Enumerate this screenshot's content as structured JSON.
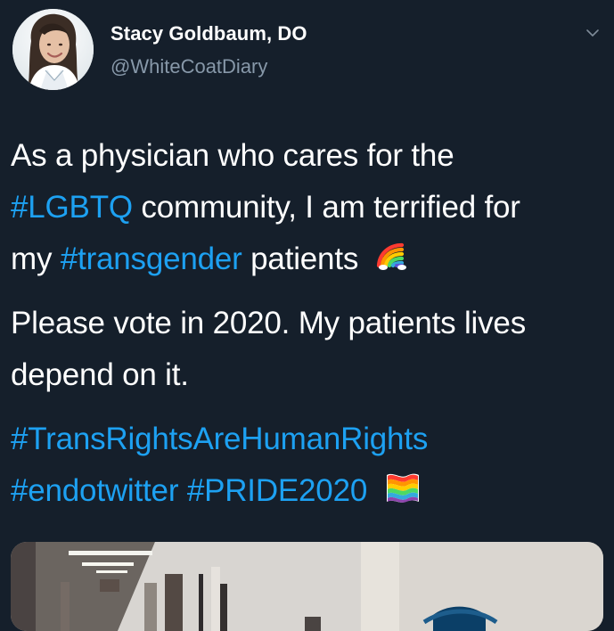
{
  "profile": {
    "display_name": "Stacy Goldbaum, DO",
    "handle": "@WhiteCoatDiary",
    "avatar_icon": "person-avatar"
  },
  "tweet": {
    "line1": "As a physician who cares for the",
    "line2_hashtag": "#LGBTQ",
    "line2_text": " community, I am terrified for",
    "line3_prefix": "my ",
    "line3_hashtag": "#transgender",
    "line3_suffix": " patients",
    "line4": "Please vote in 2020. My patients lives",
    "line5": "depend on it.",
    "hashtag1": "#TransRightsAreHumanRights",
    "hashtag2": "#endotwitter",
    "hashtag3": "#PRIDE2020",
    "emoji1": "rainbow-emoji",
    "emoji2": "pride-flag-emoji"
  },
  "colors": {
    "background": "#151f2b",
    "text": "#ffffff",
    "secondary_text": "#8798a9",
    "hashtag": "#1da1f2"
  },
  "media": {
    "content": "hospital-hallway-photo"
  },
  "icons": {
    "menu": "chevron-down-icon"
  }
}
